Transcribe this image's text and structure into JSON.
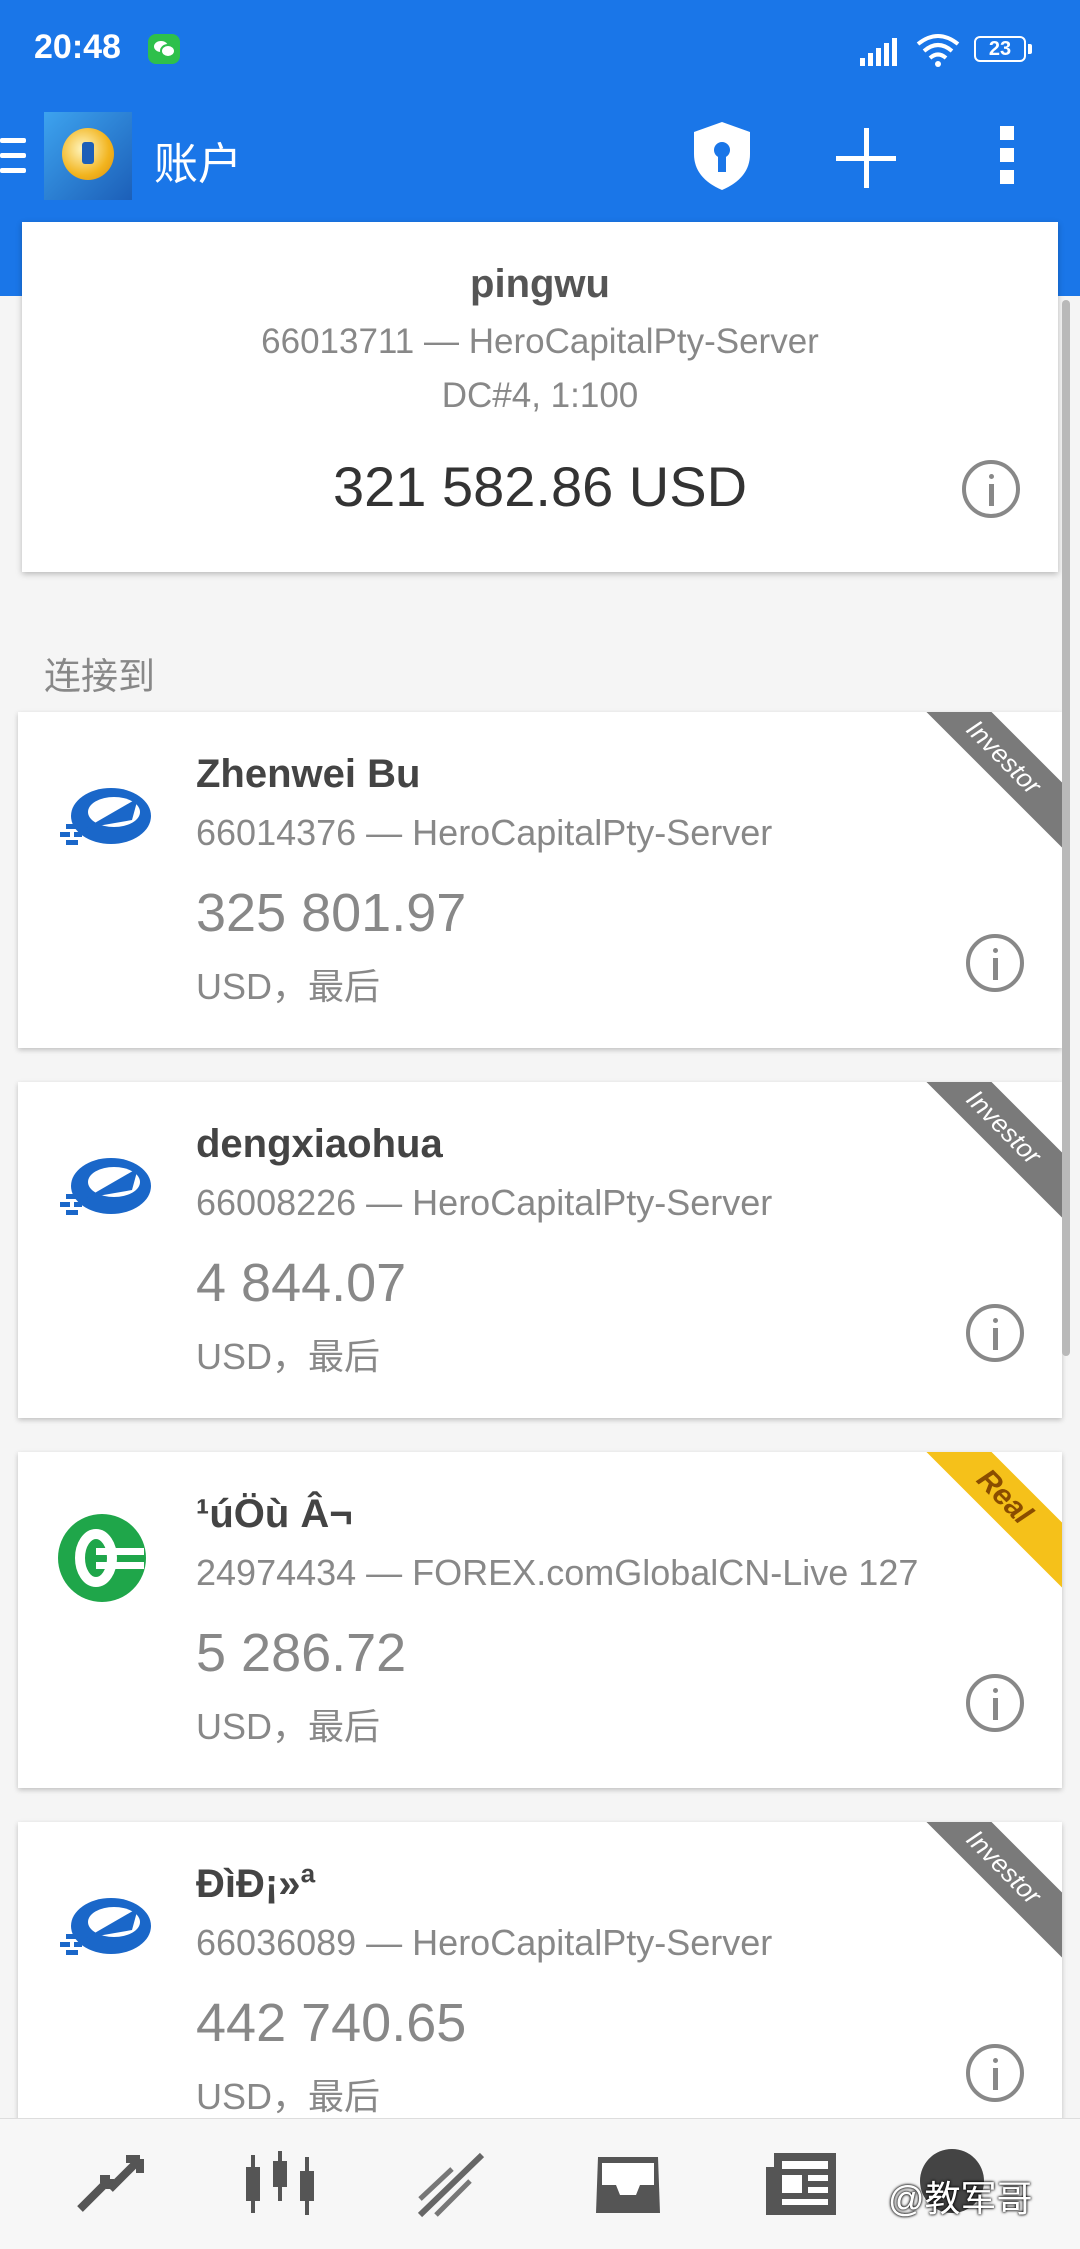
{
  "status_bar": {
    "time": "20:48",
    "battery": "23"
  },
  "toolbar": {
    "title": "账户"
  },
  "current_account": {
    "name": "pingwu",
    "server": "66013711 — HeroCapitalPty-Server",
    "meta": "DC#4, 1:100",
    "balance": "321 582.86 USD"
  },
  "section_label": "连接到",
  "accounts": [
    {
      "name": "Zhenwei Bu",
      "server": "66014376 — HeroCapitalPty-Server",
      "balance": "325 801.97",
      "currency": "USD，最后",
      "badge": "Investor",
      "logo": "metaquotes-logo-icon"
    },
    {
      "name": "dengxiaohua",
      "server": "66008226 — HeroCapitalPty-Server",
      "balance": "4 844.07",
      "currency": "USD，最后",
      "badge": "Investor",
      "logo": "metaquotes-logo-icon"
    },
    {
      "name": "¹úÖù Â¬",
      "server": "24974434 — FOREX.comGlobalCN-Live 127",
      "balance": "5 286.72",
      "currency": "USD，最后",
      "badge": "Real",
      "logo": "forex-com-logo-icon"
    },
    {
      "name": "ÐìÐ¡»ª",
      "server": "66036089 — HeroCapitalPty-Server",
      "balance": "442 740.65",
      "currency": "USD，最后",
      "badge": "Investor",
      "logo": "metaquotes-logo-icon"
    }
  ],
  "bottom_nav": [
    "quotes-icon",
    "chart-icon",
    "trade-icon",
    "history-icon",
    "news-icon",
    "avatar-icon"
  ],
  "watermark": "@教军哥",
  "colors": {
    "primary": "#1a76e8",
    "real_badge": "#f5c11a",
    "investor_badge": "#7a7a7a"
  }
}
